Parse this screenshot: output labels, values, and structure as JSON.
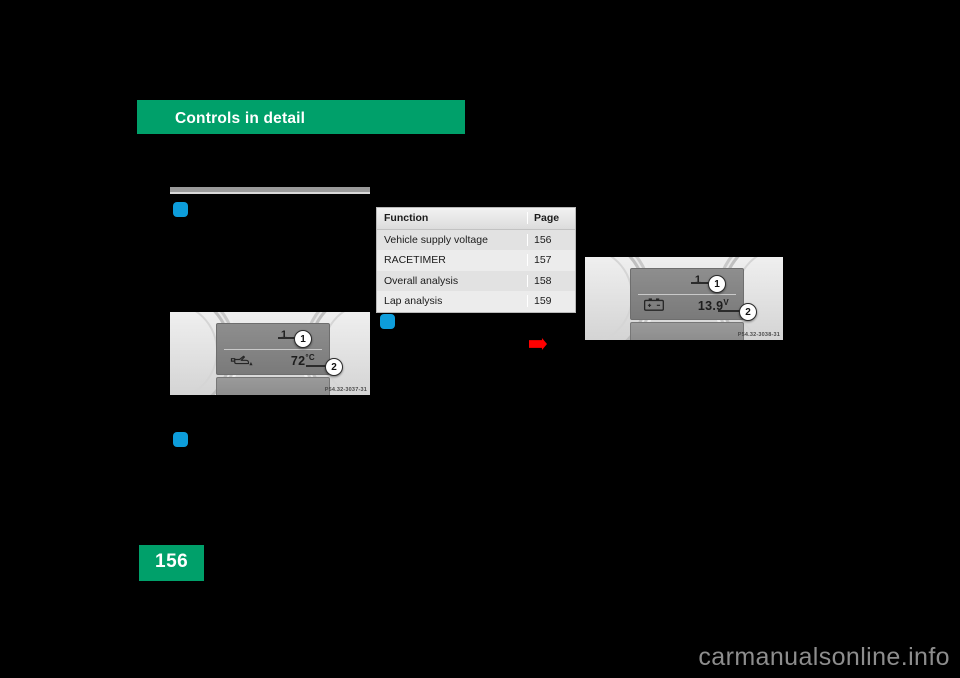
{
  "header": {
    "title": "Controls in detail"
  },
  "table": {
    "columns": [
      "Function",
      "Page"
    ],
    "rows": [
      {
        "function": "Vehicle supply voltage",
        "page": "156"
      },
      {
        "function": "RACETIMER",
        "page": "157"
      },
      {
        "function": "Overall analysis",
        "page": "158"
      },
      {
        "function": "Lap analysis",
        "page": "159"
      }
    ]
  },
  "figures": {
    "oil_temperature": {
      "top_number": "1",
      "value": "72",
      "unit": "°C",
      "icon": "oil-can-icon",
      "callout_1": "1",
      "callout_2": "2",
      "photo_id": "P54.32-3037-31"
    },
    "supply_voltage": {
      "top_number": "1",
      "value": "13.9",
      "unit": "V",
      "icon": "battery-icon",
      "callout_1": "1",
      "callout_2": "2",
      "photo_id": "P54.32-3038-31"
    }
  },
  "page_number": "156",
  "watermark": "carmanualsonline.info",
  "colors": {
    "brand_green": "#00A06A",
    "bullet_blue": "#0D9DDB",
    "marker_red": "#FF0000"
  }
}
